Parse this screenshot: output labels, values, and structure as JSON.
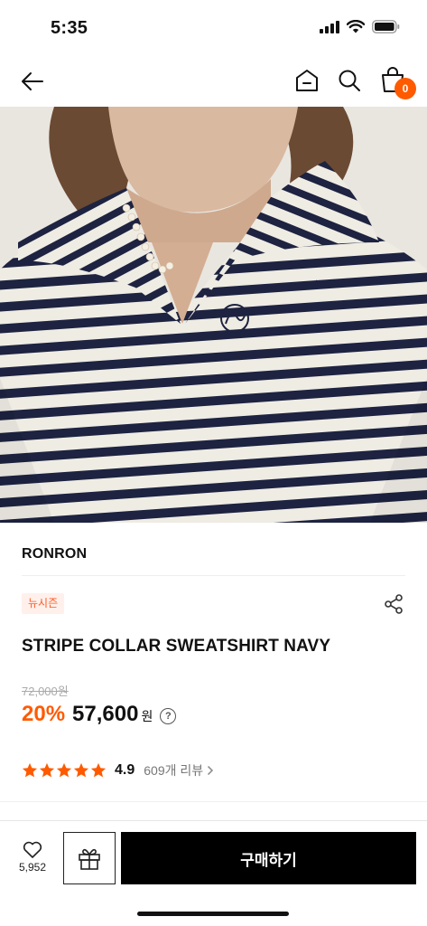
{
  "status_bar": {
    "time": "5:35"
  },
  "nav": {
    "cart_count": "0"
  },
  "product": {
    "brand": "RONRON",
    "badge": "뉴시즌",
    "name": "STRIPE COLLAR SWEATSHIRT NAVY",
    "original_price": "72,000원",
    "discount": "20%",
    "sale_price": "57,600",
    "currency": "원",
    "help_glyph": "?",
    "rating": "4.9",
    "rating_stars": 5,
    "reviews": "609개 리뷰"
  },
  "bottom_bar": {
    "like_count": "5,952",
    "buy_label": "구매하기"
  },
  "colors": {
    "accent": "#ff5a00",
    "navy_stripe": "#1d2340",
    "fabric": "#efece4"
  }
}
